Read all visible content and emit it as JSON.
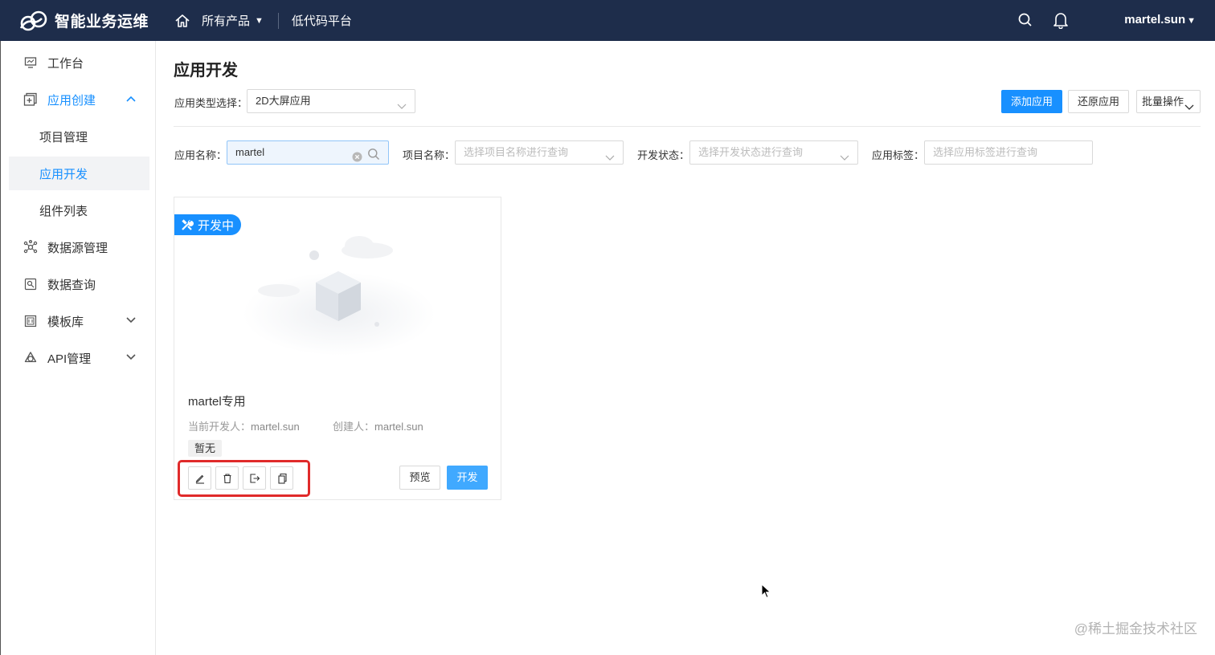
{
  "header": {
    "brand": "智能业务运维",
    "products": "所有产品",
    "lowcode": "低代码平台",
    "user": "martel.sun"
  },
  "sidebar": {
    "items": [
      {
        "label": "工作台",
        "icon": "monitor-icon"
      },
      {
        "label": "应用创建",
        "icon": "plus-square-icon"
      },
      {
        "label": "项目管理"
      },
      {
        "label": "应用开发"
      },
      {
        "label": "组件列表"
      },
      {
        "label": "数据源管理",
        "icon": "datasource-icon"
      },
      {
        "label": "数据查询",
        "icon": "query-icon"
      },
      {
        "label": "模板库",
        "icon": "template-icon"
      },
      {
        "label": "API管理",
        "icon": "api-icon"
      }
    ]
  },
  "page": {
    "title": "应用开发",
    "type_label": "应用类型选择：",
    "type_value": "2D大屏应用",
    "add_button": "添加应用",
    "restore_button": "还原应用",
    "batch_button": "批量操作"
  },
  "filters": {
    "app_name_label": "应用名称：",
    "app_name_value": "martel",
    "project_label": "项目名称：",
    "project_placeholder": "选择项目名称进行查询",
    "status_label": "开发状态：",
    "status_placeholder": "选择开发状态进行查询",
    "tag_label": "应用标签：",
    "tag_placeholder": "选择应用标签进行查询"
  },
  "card": {
    "badge": "开发中",
    "name": "martel专用",
    "developer_label": "当前开发人：",
    "developer": "martel.sun",
    "creator_label": "创建人：",
    "creator": "martel.sun",
    "tag": "暂无",
    "preview_button": "预览",
    "dev_button": "开发"
  },
  "watermark": "@稀土掘金技术社区",
  "colors": {
    "header_bg": "#1e2d4b",
    "primary": "#1890ff",
    "highlight": "#e02a2a"
  }
}
